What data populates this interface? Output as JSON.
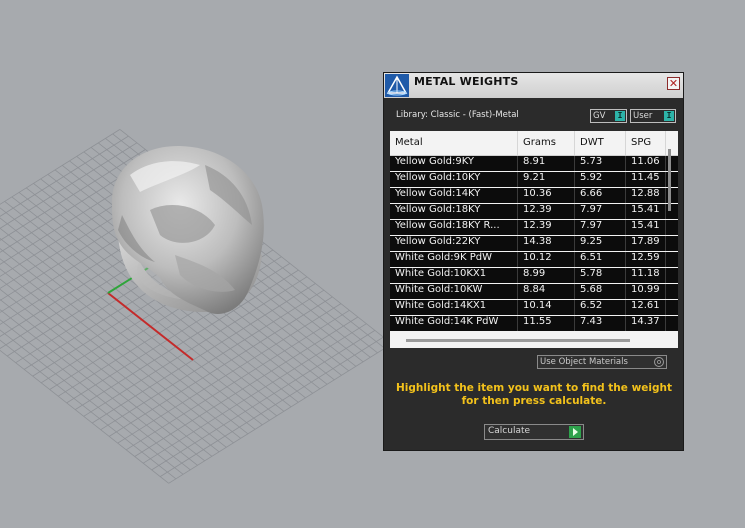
{
  "panel": {
    "title": "METAL WEIGHTS",
    "close_glyph": "✕",
    "library_label": "Library: Classic - (Fast)-Metal",
    "unit_toggles": [
      {
        "label": "GV",
        "icon": "I"
      },
      {
        "label": "User",
        "icon": "I"
      }
    ],
    "table": {
      "columns": [
        "Metal",
        "Grams",
        "DWT",
        "SPG"
      ],
      "rows": [
        [
          "Yellow Gold:9KY",
          "8.91",
          "5.73",
          "11.06"
        ],
        [
          "Yellow Gold:10KY",
          "9.21",
          "5.92",
          "11.45"
        ],
        [
          "Yellow Gold:14KY",
          "10.36",
          "6.66",
          "12.88"
        ],
        [
          "Yellow Gold:18KY",
          "12.39",
          "7.97",
          "15.41"
        ],
        [
          "Yellow Gold:18KY R...",
          "12.39",
          "7.97",
          "15.41"
        ],
        [
          "Yellow Gold:22KY",
          "14.38",
          "9.25",
          "17.89"
        ],
        [
          "White Gold:9K PdW",
          "10.12",
          "6.51",
          "12.59"
        ],
        [
          "White Gold:10KX1",
          "8.99",
          "5.78",
          "11.18"
        ],
        [
          "White Gold:10KW",
          "8.84",
          "5.68",
          "10.99"
        ],
        [
          "White Gold:14KX1",
          "10.14",
          "6.52",
          "12.61"
        ],
        [
          "White Gold:14K PdW",
          "11.55",
          "7.43",
          "14.37"
        ]
      ]
    },
    "object_materials_label": "Use Object Materials",
    "instructions": "Highlight the item you want to find the weight for then press calculate.",
    "calculate_label": "Calculate"
  },
  "colors": {
    "viewport_bg": "#a7aaae",
    "grid_line": "#8e9196",
    "axis_x": "#c42a2a",
    "axis_y": "#2ea53a",
    "panel_bg": "#2b2b2b",
    "instruction_text": "#f3c21b",
    "toggle_icon": "#2db3a8",
    "calculate_icon": "#2ea24c"
  }
}
